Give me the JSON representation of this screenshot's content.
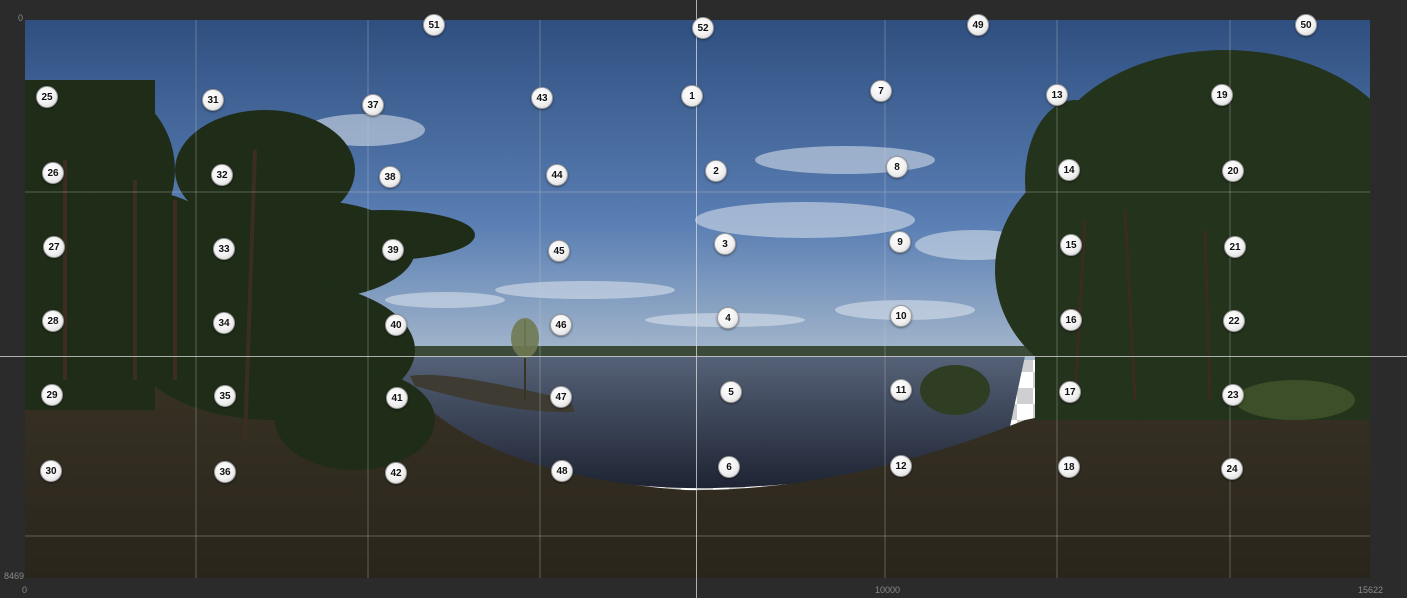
{
  "ruler": {
    "top_left": "0",
    "left_bottom": "8469",
    "bottom_start": "0",
    "bottom_mid": "10000",
    "bottom_end": "15622"
  },
  "panorama": {
    "subject": "lake-panorama-equirectangular",
    "sky_color": "#4a6fa5",
    "water_color": "#2e3444",
    "tree_color": "#22301a",
    "ground_color": "#3a3224"
  },
  "markers": [
    {
      "id": "1"
    },
    {
      "id": "2"
    },
    {
      "id": "3"
    },
    {
      "id": "4"
    },
    {
      "id": "5"
    },
    {
      "id": "6"
    },
    {
      "id": "7"
    },
    {
      "id": "8"
    },
    {
      "id": "9"
    },
    {
      "id": "10"
    },
    {
      "id": "11"
    },
    {
      "id": "12"
    },
    {
      "id": "13"
    },
    {
      "id": "14"
    },
    {
      "id": "15"
    },
    {
      "id": "16"
    },
    {
      "id": "17"
    },
    {
      "id": "18"
    },
    {
      "id": "19"
    },
    {
      "id": "20"
    },
    {
      "id": "21"
    },
    {
      "id": "22"
    },
    {
      "id": "23"
    },
    {
      "id": "24"
    },
    {
      "id": "25"
    },
    {
      "id": "26"
    },
    {
      "id": "27"
    },
    {
      "id": "28"
    },
    {
      "id": "29"
    },
    {
      "id": "30"
    },
    {
      "id": "31"
    },
    {
      "id": "32"
    },
    {
      "id": "33"
    },
    {
      "id": "34"
    },
    {
      "id": "35"
    },
    {
      "id": "36"
    },
    {
      "id": "37"
    },
    {
      "id": "38"
    },
    {
      "id": "39"
    },
    {
      "id": "40"
    },
    {
      "id": "41"
    },
    {
      "id": "42"
    },
    {
      "id": "43"
    },
    {
      "id": "44"
    },
    {
      "id": "45"
    },
    {
      "id": "46"
    },
    {
      "id": "47"
    },
    {
      "id": "48"
    },
    {
      "id": "49"
    },
    {
      "id": "50"
    },
    {
      "id": "51"
    },
    {
      "id": "52"
    }
  ]
}
